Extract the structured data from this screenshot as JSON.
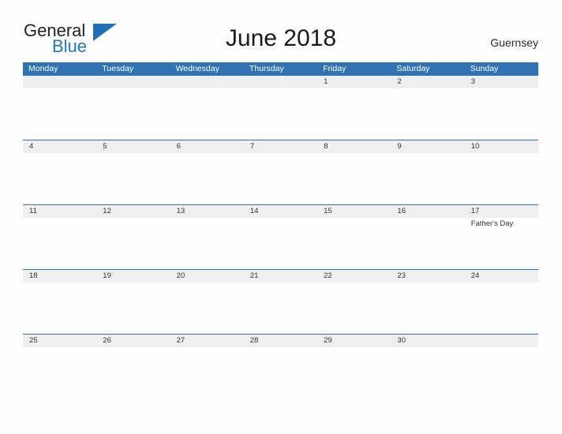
{
  "brand": {
    "name_part1": "General",
    "name_part2": "Blue",
    "flag_icon": "triangle-flag-icon"
  },
  "header": {
    "title": "June 2018",
    "locale": "Guernsey"
  },
  "colors": {
    "header_blue": "#2f73b3",
    "date_band_gray": "#efefef",
    "brand_blue": "#2079c6",
    "page_background": "#fdfdfd",
    "text": "#333333"
  },
  "calendar": {
    "weekdays": [
      "Monday",
      "Tuesday",
      "Wednesday",
      "Thursday",
      "Friday",
      "Saturday",
      "Sunday"
    ],
    "weeks": [
      {
        "days": [
          {
            "date": "",
            "events": []
          },
          {
            "date": "",
            "events": []
          },
          {
            "date": "",
            "events": []
          },
          {
            "date": "",
            "events": []
          },
          {
            "date": "1",
            "events": []
          },
          {
            "date": "2",
            "events": []
          },
          {
            "date": "3",
            "events": []
          }
        ]
      },
      {
        "days": [
          {
            "date": "4",
            "events": []
          },
          {
            "date": "5",
            "events": []
          },
          {
            "date": "6",
            "events": []
          },
          {
            "date": "7",
            "events": []
          },
          {
            "date": "8",
            "events": []
          },
          {
            "date": "9",
            "events": []
          },
          {
            "date": "10",
            "events": []
          }
        ]
      },
      {
        "days": [
          {
            "date": "11",
            "events": []
          },
          {
            "date": "12",
            "events": []
          },
          {
            "date": "13",
            "events": []
          },
          {
            "date": "14",
            "events": []
          },
          {
            "date": "15",
            "events": []
          },
          {
            "date": "16",
            "events": []
          },
          {
            "date": "17",
            "events": [
              "Father's Day"
            ]
          }
        ]
      },
      {
        "days": [
          {
            "date": "18",
            "events": []
          },
          {
            "date": "19",
            "events": []
          },
          {
            "date": "20",
            "events": []
          },
          {
            "date": "21",
            "events": []
          },
          {
            "date": "22",
            "events": []
          },
          {
            "date": "23",
            "events": []
          },
          {
            "date": "24",
            "events": []
          }
        ]
      },
      {
        "days": [
          {
            "date": "25",
            "events": []
          },
          {
            "date": "26",
            "events": []
          },
          {
            "date": "27",
            "events": []
          },
          {
            "date": "28",
            "events": []
          },
          {
            "date": "29",
            "events": []
          },
          {
            "date": "30",
            "events": []
          },
          {
            "date": "",
            "events": []
          }
        ]
      }
    ]
  }
}
